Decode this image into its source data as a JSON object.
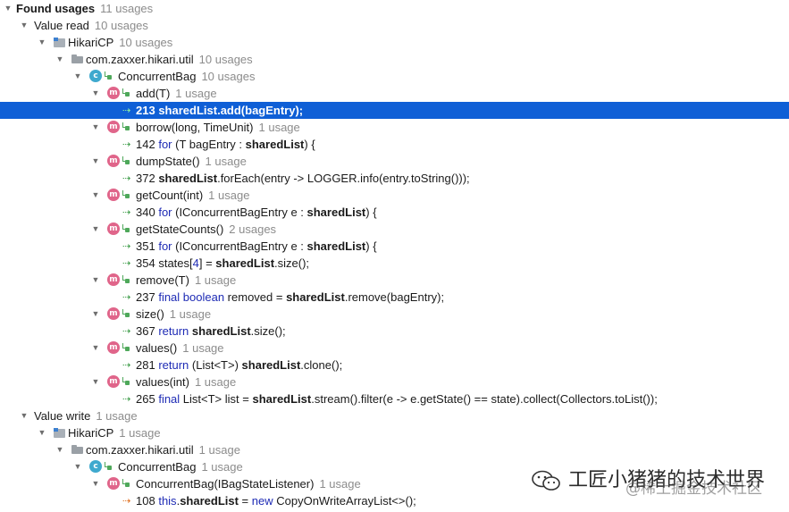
{
  "results": {
    "header": {
      "label": "Found usages",
      "count": "11 usages"
    },
    "rows": [
      {
        "kind": "group",
        "label": "Value read",
        "count": "10 usages"
      },
      {
        "kind": "module",
        "label": "HikariCP",
        "count": "10 usages"
      },
      {
        "kind": "package",
        "label": "com.zaxxer.hikari.util",
        "count": "10 usages"
      },
      {
        "kind": "class",
        "label": "ConcurrentBag",
        "count": "10 usages"
      },
      {
        "kind": "method",
        "label": "add(T)",
        "count": "1 usage"
      },
      {
        "kind": "usage",
        "access": "read",
        "selected": true,
        "line": "213",
        "code": [
          {
            "t": "sharedList",
            "s": "hl"
          },
          {
            "t": ".add(bagEntry);",
            "s": ""
          }
        ]
      },
      {
        "kind": "method",
        "label": "borrow(long, TimeUnit)",
        "count": "1 usage"
      },
      {
        "kind": "usage",
        "access": "read",
        "line": "142",
        "code": [
          {
            "t": "for",
            "s": "kw"
          },
          {
            "t": " (T bagEntry : ",
            "s": ""
          },
          {
            "t": "sharedList",
            "s": "hl"
          },
          {
            "t": ") {",
            "s": ""
          }
        ]
      },
      {
        "kind": "method",
        "label": "dumpState()",
        "count": "1 usage"
      },
      {
        "kind": "usage",
        "access": "read",
        "line": "372",
        "code": [
          {
            "t": "sharedList",
            "s": "hl"
          },
          {
            "t": ".forEach(entry -> LOGGER.info(entry.toString()));",
            "s": ""
          }
        ]
      },
      {
        "kind": "method",
        "label": "getCount(int)",
        "count": "1 usage"
      },
      {
        "kind": "usage",
        "access": "read",
        "line": "340",
        "code": [
          {
            "t": "for",
            "s": "kw"
          },
          {
            "t": " (IConcurrentBagEntry e : ",
            "s": ""
          },
          {
            "t": "sharedList",
            "s": "hl"
          },
          {
            "t": ") {",
            "s": ""
          }
        ]
      },
      {
        "kind": "method",
        "label": "getStateCounts()",
        "count": "2 usages"
      },
      {
        "kind": "usage",
        "access": "read",
        "line": "351",
        "code": [
          {
            "t": "for",
            "s": "kw"
          },
          {
            "t": " (IConcurrentBagEntry e : ",
            "s": ""
          },
          {
            "t": "sharedList",
            "s": "hl"
          },
          {
            "t": ") {",
            "s": ""
          }
        ]
      },
      {
        "kind": "usage",
        "access": "read",
        "line": "354",
        "code": [
          {
            "t": "states[",
            "s": ""
          },
          {
            "t": "4",
            "s": "kw"
          },
          {
            "t": "] = ",
            "s": ""
          },
          {
            "t": "sharedList",
            "s": "hl"
          },
          {
            "t": ".size();",
            "s": ""
          }
        ]
      },
      {
        "kind": "method",
        "label": "remove(T)",
        "count": "1 usage"
      },
      {
        "kind": "usage",
        "access": "read",
        "line": "237",
        "code": [
          {
            "t": "final boolean",
            "s": "kw"
          },
          {
            "t": " removed = ",
            "s": ""
          },
          {
            "t": "sharedList",
            "s": "hl"
          },
          {
            "t": ".remove(bagEntry);",
            "s": ""
          }
        ]
      },
      {
        "kind": "method",
        "label": "size()",
        "count": "1 usage"
      },
      {
        "kind": "usage",
        "access": "read",
        "line": "367",
        "code": [
          {
            "t": "return",
            "s": "kw"
          },
          {
            "t": " ",
            "s": ""
          },
          {
            "t": "sharedList",
            "s": "hl"
          },
          {
            "t": ".size();",
            "s": ""
          }
        ]
      },
      {
        "kind": "method",
        "label": "values()",
        "count": "1 usage"
      },
      {
        "kind": "usage",
        "access": "read",
        "line": "281",
        "code": [
          {
            "t": "return",
            "s": "kw"
          },
          {
            "t": " (List<T>) ",
            "s": ""
          },
          {
            "t": "sharedList",
            "s": "hl"
          },
          {
            "t": ".clone();",
            "s": ""
          }
        ]
      },
      {
        "kind": "method",
        "label": "values(int)",
        "count": "1 usage"
      },
      {
        "kind": "usage",
        "access": "read",
        "line": "265",
        "code": [
          {
            "t": "final",
            "s": "kw"
          },
          {
            "t": " List<T> list = ",
            "s": ""
          },
          {
            "t": "sharedList",
            "s": "hl"
          },
          {
            "t": ".stream().filter(e -> e.getState() == state).collect(Collectors.toList());",
            "s": ""
          }
        ]
      },
      {
        "kind": "group",
        "label": "Value write",
        "count": "1 usage"
      },
      {
        "kind": "module",
        "label": "HikariCP",
        "count": "1 usage"
      },
      {
        "kind": "package",
        "label": "com.zaxxer.hikari.util",
        "count": "1 usage"
      },
      {
        "kind": "class",
        "label": "ConcurrentBag",
        "count": "1 usage"
      },
      {
        "kind": "method",
        "label": "ConcurrentBag(IBagStateListener)",
        "count": "1 usage"
      },
      {
        "kind": "usage",
        "access": "write",
        "line": "108",
        "code": [
          {
            "t": "this",
            "s": "kw"
          },
          {
            "t": ".",
            "s": ""
          },
          {
            "t": "sharedList",
            "s": "hl"
          },
          {
            "t": " = ",
            "s": ""
          },
          {
            "t": "new",
            "s": "kw"
          },
          {
            "t": " CopyOnWriteArrayList<>();",
            "s": ""
          }
        ]
      }
    ]
  },
  "watermark": {
    "text": "工匠小猪猪的技术世界",
    "sub": "@稀土掘金技术社区",
    "icon": "wechat-icon"
  },
  "colors": {
    "selection": "#0f5fd6",
    "keyword": "#1e2bb5",
    "read_usage": "#3a9a45",
    "write_usage": "#e07020",
    "method_icon": "#e0658a",
    "class_icon": "#3fa9ce"
  }
}
